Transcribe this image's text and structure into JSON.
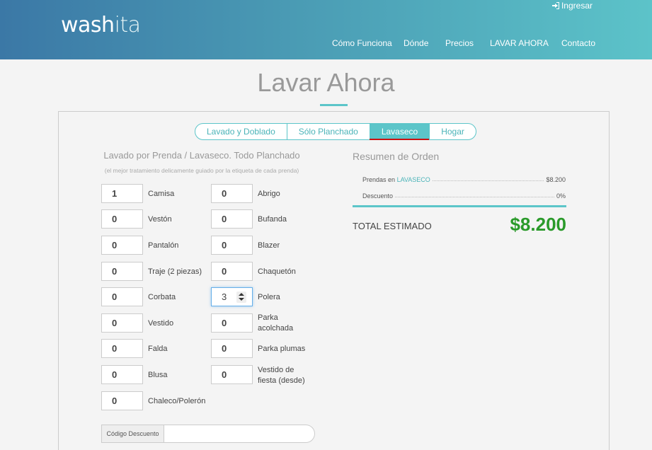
{
  "header": {
    "logo_bold": "wash",
    "logo_light": "ita",
    "login": "Ingresar",
    "nav": [
      "Cómo Funciona",
      "Dónde",
      "Precios",
      "LAVAR AHORA",
      "Contacto"
    ]
  },
  "page_title": "Lavar Ahora",
  "tabs": [
    "Lavado y Doblado",
    "Sólo Planchado",
    "Lavaseco",
    "Hogar"
  ],
  "active_tab": "Lavaseco",
  "left": {
    "title": "Lavado por Prenda / Lavaseco. Todo Planchado",
    "subtitle": "(el mejor tratamiento delicamente guiado por la etiqueta de cada prenda)"
  },
  "items_left": [
    {
      "qty": "1",
      "label": "Camisa"
    },
    {
      "qty": "0",
      "label": "Vestón"
    },
    {
      "qty": "0",
      "label": "Pantalón"
    },
    {
      "qty": "0",
      "label": "Traje (2 piezas)"
    },
    {
      "qty": "0",
      "label": "Corbata"
    },
    {
      "qty": "0",
      "label": "Vestido"
    },
    {
      "qty": "0",
      "label": "Falda"
    },
    {
      "qty": "0",
      "label": "Blusa"
    },
    {
      "qty": "0",
      "label": "Chaleco/Polerón"
    }
  ],
  "items_right": [
    {
      "qty": "0",
      "label": "Abrigo"
    },
    {
      "qty": "0",
      "label": "Bufanda"
    },
    {
      "qty": "0",
      "label": "Blazer"
    },
    {
      "qty": "0",
      "label": "Chaquetón"
    },
    {
      "qty": "3",
      "label": "Polera"
    },
    {
      "qty": "0",
      "label": "Parka acolchada"
    },
    {
      "qty": "0",
      "label": "Parka plumas"
    },
    {
      "qty": "0",
      "label": "Vestido de fiesta (desde)"
    }
  ],
  "discount": {
    "label": "Código Descuento",
    "value": ""
  },
  "summary": {
    "title": "Resumen de Orden",
    "row1_prefix": "Prendas en",
    "row1_service": "LAVASECO",
    "row1_value": "$8.200",
    "row2_label": "Descuento",
    "row2_value": "0%",
    "total_label": "TOTAL ESTIMADO",
    "total_value": "$8.200"
  },
  "colors": {
    "accent": "#5cc5c9",
    "total": "#2a9a2a"
  },
  "icons": {
    "login": "sign-in-icon",
    "spinner": "number-spinner-icon"
  }
}
